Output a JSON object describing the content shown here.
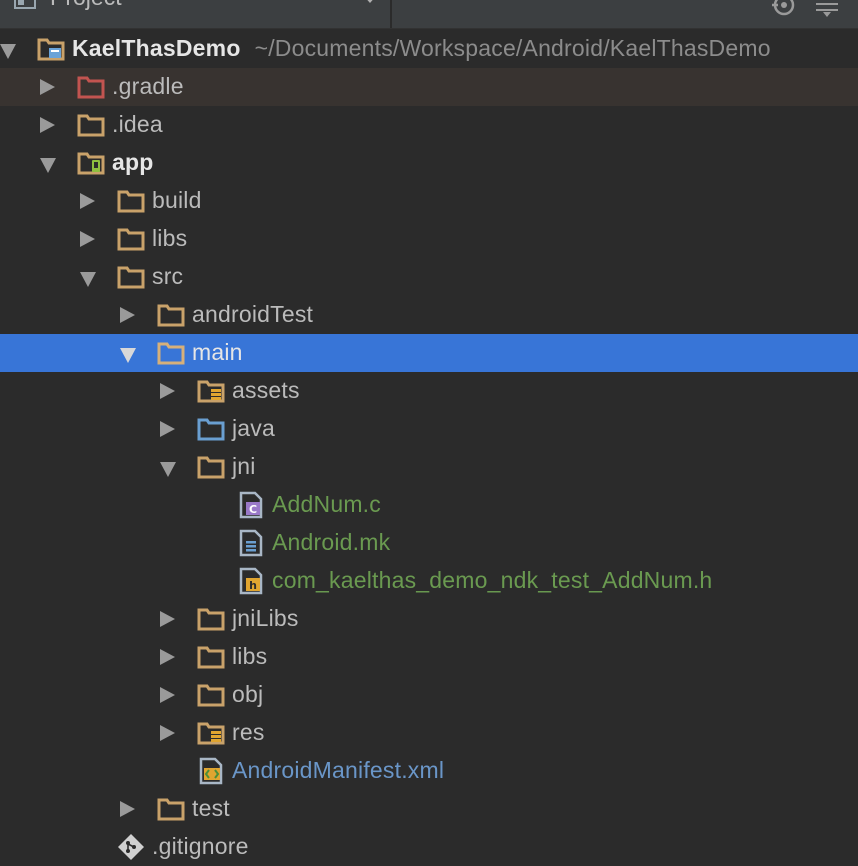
{
  "header": {
    "title": "Project"
  },
  "root": {
    "name": "KaelThasDemo",
    "path": "~/Documents/Workspace/Android/KaelThasDemo"
  },
  "items": {
    "gradle": ".gradle",
    "idea": ".idea",
    "app": "app",
    "build": "build",
    "libs": "libs",
    "src": "src",
    "androidTest": "androidTest",
    "main": "main",
    "assets": "assets",
    "java": "java",
    "jni": "jni",
    "addnum_c": "AddNum.c",
    "android_mk": "Android.mk",
    "addnum_h": "com_kaelthas_demo_ndk_test_AddNum.h",
    "jniLibs": "jniLibs",
    "main_libs": "libs",
    "obj": "obj",
    "res": "res",
    "manifest": "AndroidManifest.xml",
    "test": "test",
    "gitignore": ".gitignore"
  },
  "file_badges": {
    "c": "C",
    "h": "h"
  },
  "colors": {
    "background": "#2b2b2b",
    "selection": "#3875d7",
    "folder": "#c9a26a",
    "excluded_folder": "#c25450",
    "source_folder": "#6a9fd1",
    "vcs_added_text": "#6a9a50",
    "modified_text": "#6a96c8"
  },
  "selected_item": "main"
}
